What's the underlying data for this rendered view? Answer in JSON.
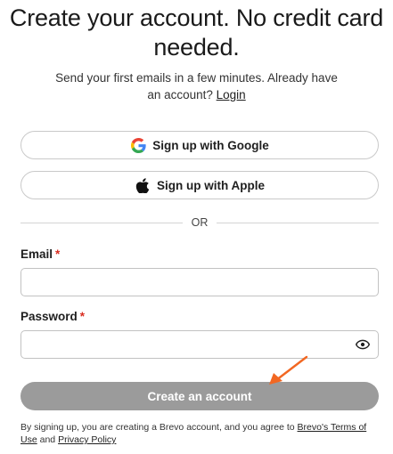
{
  "header": {
    "headline": "Create your account. No credit card needed."
  },
  "subtitle": {
    "text": "Send your first emails in a few minutes. Already have an account?",
    "login_link": "Login"
  },
  "oauth": {
    "google_label": "Sign up with Google",
    "apple_label": "Sign up with Apple"
  },
  "divider": {
    "text": "OR"
  },
  "form": {
    "email": {
      "label": "Email",
      "required_mark": "*",
      "value": "",
      "placeholder": ""
    },
    "password": {
      "label": "Password",
      "required_mark": "*",
      "value": "",
      "placeholder": ""
    },
    "submit_label": "Create an account",
    "submit_color": "#9b9b9b"
  },
  "terms": {
    "prefix": "By signing up, you are creating a Brevo account, and you agree to",
    "terms_link": "Brevo's Terms of Use",
    "conjunction": "and",
    "privacy_link": "Privacy Policy"
  },
  "annotation": {
    "arrow_color": "#f26722"
  },
  "icons": [
    "google-icon",
    "apple-icon",
    "eye-icon",
    "arrow-annotation"
  ]
}
